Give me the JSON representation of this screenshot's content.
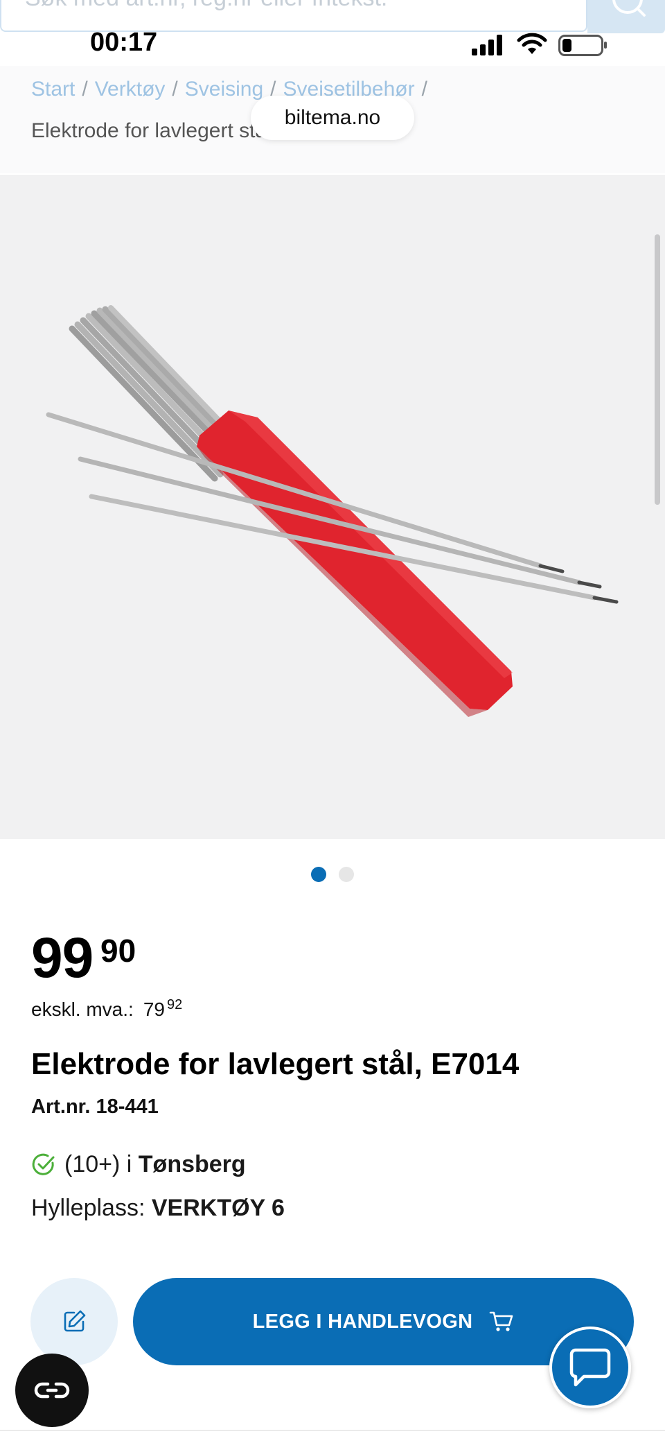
{
  "search": {
    "placeholder": "Søk med art.nr, reg.nr eller fritekst.",
    "icon": "search-icon"
  },
  "status_bar": {
    "time": "00:17",
    "icons": [
      "signal-icon",
      "wifi-icon",
      "battery-icon"
    ],
    "battery_level": 0.2
  },
  "breadcrumb": {
    "items": [
      "Start",
      "Verktøy",
      "Sveising",
      "Sveisetilbehør"
    ],
    "separator": "/",
    "current": "Elektrode for lavlegert stål, E7014"
  },
  "browser": {
    "url": "biltema.no"
  },
  "gallery": {
    "image_count": 2,
    "active_index": 0,
    "colors": {
      "active_dot": "#0a6db5",
      "inactive_dot": "#e6e6e6"
    }
  },
  "price": {
    "whole": "99",
    "cents": "90",
    "ex_vat_label": "ekskl. mva.:",
    "ex_vat_whole": "79",
    "ex_vat_cents": "92"
  },
  "product": {
    "title": "Elektrode for lavlegert stål, E7014",
    "art_nr": "Art.nr. 18-441"
  },
  "stock": {
    "count": "(10+) i",
    "store": "Tønsberg",
    "icon": "check-circle-icon",
    "shelf_label": "Hylleplass:",
    "shelf_value": "VERKTØY 6"
  },
  "actions": {
    "note_icon": "edit-note-icon",
    "cart_label": "LEGG I HANDLEVOGN",
    "cart_icon": "cart-icon",
    "chat_icon": "chat-icon",
    "cookie_icon": "cookie-settings-icon"
  },
  "colors": {
    "brand_blue": "#0a6db5",
    "link_blue": "#9ec3e3",
    "check_green": "#4caf3a",
    "handle_red": "#e0242e"
  }
}
